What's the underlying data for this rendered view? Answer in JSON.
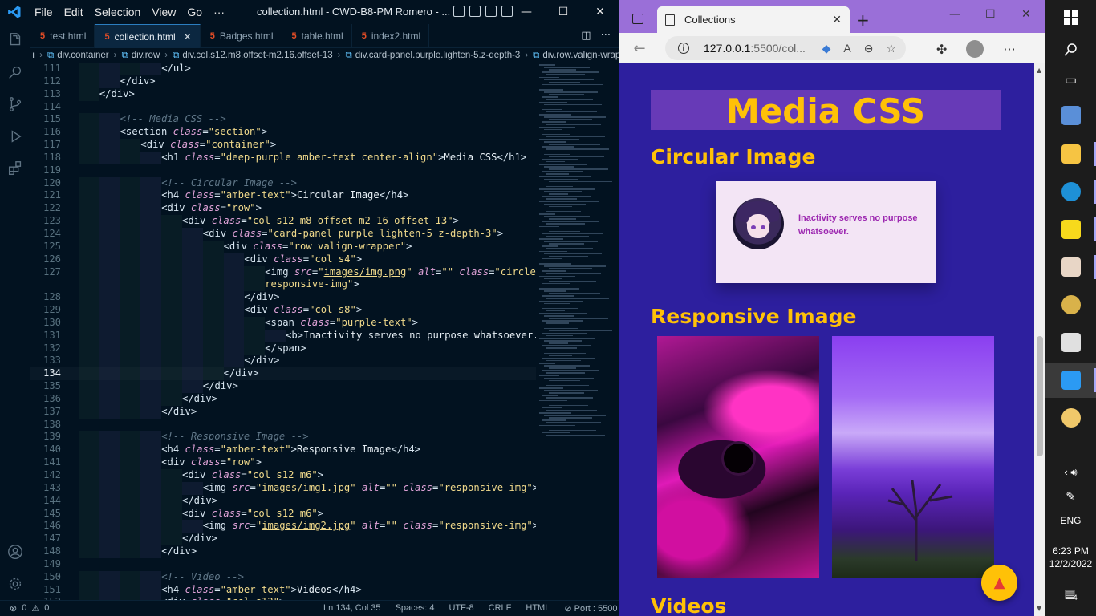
{
  "vscode": {
    "menu": [
      "File",
      "Edit",
      "Selection",
      "View",
      "Go",
      "···"
    ],
    "window_title": "collection.html - CWD-B8-PM Romero - ...",
    "tabs": [
      {
        "label": "test.html",
        "active": false
      },
      {
        "label": "collection.html",
        "active": true
      },
      {
        "label": "Badges.html",
        "active": false
      },
      {
        "label": "table.html",
        "active": false
      },
      {
        "label": "index2.html",
        "active": false
      }
    ],
    "breadcrumb": [
      "div.container",
      "div.row",
      "div.col.s12.m8.offset-m2.16.offset-13",
      "div.card-panel.purple.lighten-5.z-depth-3",
      "div.row.valign-wrapper"
    ],
    "breadcrumb_prefix": "ı",
    "current_line": "134",
    "status": {
      "errors": "0",
      "warnings": "0",
      "position": "Ln 134, Col 35",
      "spaces": "Spaces: 4",
      "encoding": "UTF-8",
      "eol": "CRLF",
      "language": "HTML",
      "port": "Port : 5500"
    }
  },
  "browser": {
    "tab_title": "Collections",
    "url_host": "127.0.0.1",
    "url_path": ":5500/col...",
    "page": {
      "h1": "Media CSS",
      "h4_circular": "Circular Image",
      "quote": "Inactivity serves no purpose whatsoever.",
      "h4_responsive": "Responsive Image",
      "h4_videos": "Videos"
    },
    "colors": {
      "page_bg": "#2d1f9e",
      "deep_purple": "#673ab7",
      "amber": "#ffc107",
      "purple_text": "#9c27b0",
      "purple_lighten_5": "#f3e5f5"
    }
  },
  "taskbar": {
    "lang": "ENG",
    "time": "6:23 PM",
    "date": "12/2/2022",
    "notifications": "4"
  }
}
